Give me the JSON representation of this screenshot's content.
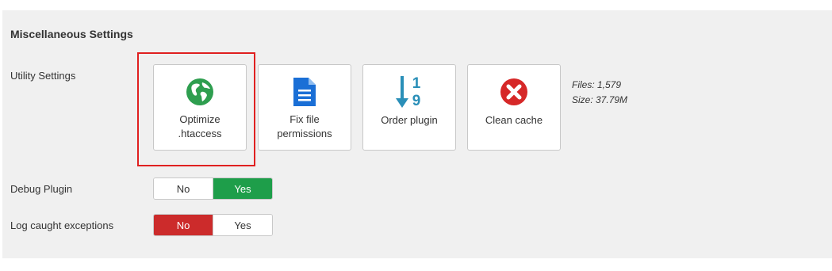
{
  "section": {
    "title": "Miscellaneous Settings"
  },
  "utility": {
    "label": "Utility Settings",
    "buttons": [
      {
        "label_line1": "Optimize",
        "label_line2": ".htaccess",
        "icon": "globe-icon"
      },
      {
        "label_line1": "Fix file",
        "label_line2": "permissions",
        "icon": "file-icon"
      },
      {
        "label": "Order plugin",
        "icon": "sort-numeric-icon"
      },
      {
        "label": "Clean cache",
        "icon": "delete-circle-icon"
      }
    ],
    "files": "Files: 1,579",
    "size": "Size: 37.79M"
  },
  "debug_plugin": {
    "label": "Debug Plugin",
    "no": "No",
    "yes": "Yes",
    "selected": "Yes"
  },
  "log_exceptions": {
    "label": "Log caught exceptions",
    "no": "No",
    "yes": "Yes",
    "selected": "No"
  },
  "colors": {
    "highlight": "#e02020",
    "yes_active": "#1e9e4a",
    "no_active": "#cc2b2b",
    "globe": "#2e9e4f",
    "file": "#1a6fd6",
    "sort": "#2a8fb8",
    "delete": "#d62828"
  },
  "icons": [
    "globe-icon",
    "file-icon",
    "sort-numeric-icon",
    "delete-circle-icon"
  ]
}
